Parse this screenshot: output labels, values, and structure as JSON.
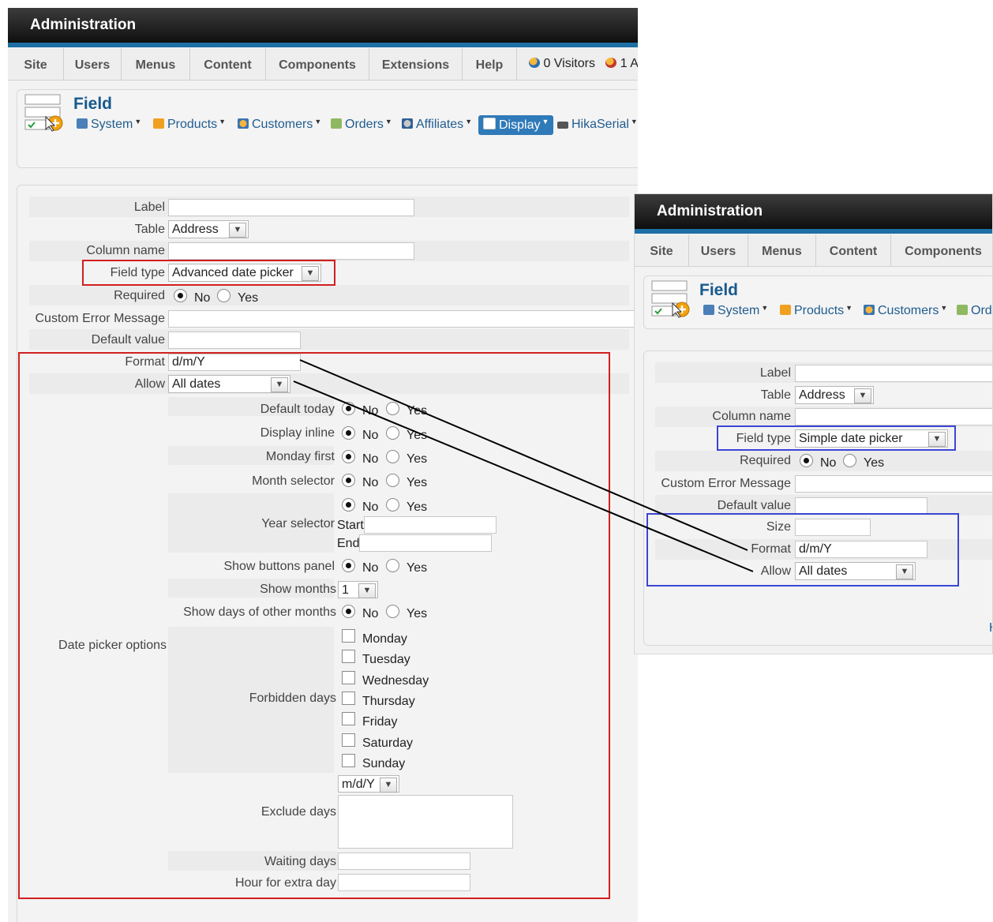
{
  "left": {
    "title": "Administration",
    "menu": [
      "Site",
      "Users",
      "Menus",
      "Content",
      "Components",
      "Extensions",
      "Help"
    ],
    "status": {
      "visitors": "0 Visitors",
      "admins": "1 A"
    },
    "page_title": "Field",
    "toolbar": [
      "System",
      "Products",
      "Customers",
      "Orders",
      "Affiliates",
      "Display",
      "HikaSerial"
    ],
    "form": {
      "label": "Label",
      "table": "Table",
      "table_value": "Address",
      "column_name": "Column name",
      "field_type": "Field type",
      "field_type_value": "Advanced date picker",
      "required": "Required",
      "no": "No",
      "yes": "Yes",
      "custom_error": "Custom Error Message",
      "default_value": "Default value",
      "format": "Format",
      "format_value": "d/m/Y",
      "allow": "Allow",
      "allow_value": "All dates",
      "date_picker_options": "Date picker options",
      "default_today": "Default today",
      "display_inline": "Display inline",
      "monday_first": "Monday first",
      "month_selector": "Month selector",
      "year_selector": "Year selector",
      "start": "Start",
      "end": "End",
      "show_buttons_panel": "Show buttons panel",
      "show_months": "Show months",
      "show_months_value": "1",
      "show_days_other": "Show days of other months",
      "forbidden_days": "Forbidden days",
      "days": [
        "Monday",
        "Tuesday",
        "Wednesday",
        "Thursday",
        "Friday",
        "Saturday",
        "Sunday"
      ],
      "exclude_days": "Exclude days",
      "exclude_format": "m/d/Y",
      "waiting_days": "Waiting days",
      "hour_extra_day": "Hour for extra day"
    }
  },
  "right": {
    "title": "Administration",
    "menu": [
      "Site",
      "Users",
      "Menus",
      "Content",
      "Components"
    ],
    "page_title": "Field",
    "toolbar": [
      "System",
      "Products",
      "Customers",
      "Ord"
    ],
    "form": {
      "label": "Label",
      "table": "Table",
      "table_value": "Address",
      "column_name": "Column name",
      "field_type": "Field type",
      "field_type_value": "Simple date picker",
      "required": "Required",
      "no": "No",
      "yes": "Yes",
      "custom_error": "Custom Error Message",
      "default_value": "Default value",
      "size": "Size",
      "format": "Format",
      "format_value": "d/m/Y",
      "allow": "Allow",
      "allow_value": "All dates",
      "footer_letter": "H"
    }
  },
  "colors": {
    "highlight_red": "#d21f1f",
    "highlight_blue": "#3b46d4",
    "header_blue": "#1d6fa5",
    "title_blue": "#175a8d"
  }
}
